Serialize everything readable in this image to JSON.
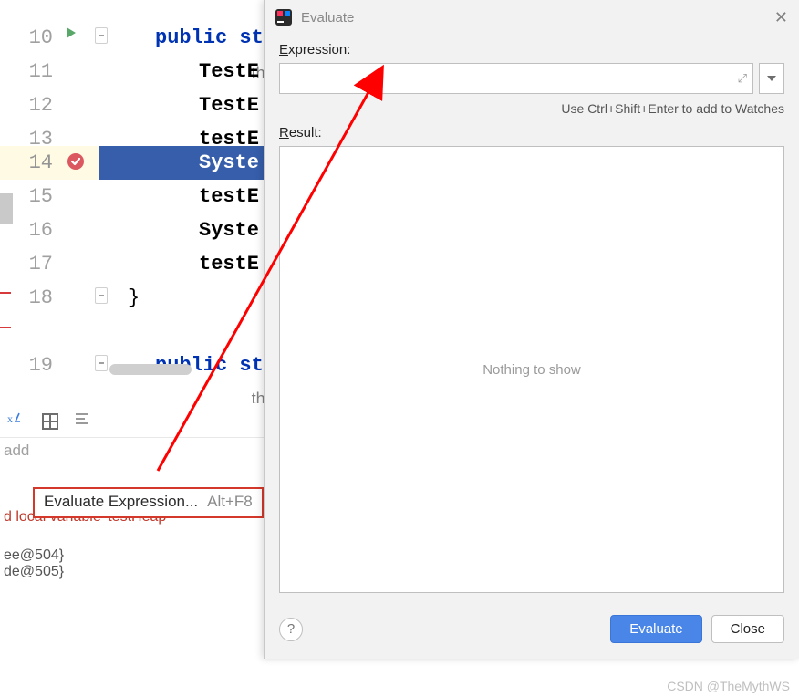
{
  "editor": {
    "lines": [
      {
        "num": "",
        "text": "themyth"
      },
      {
        "num": "10",
        "text": "public st"
      },
      {
        "num": "11",
        "text": "TestE"
      },
      {
        "num": "12",
        "text": "TestE"
      },
      {
        "num": "13",
        "text": "testE"
      },
      {
        "num": "14",
        "text": "Syste"
      },
      {
        "num": "15",
        "text": "testE"
      },
      {
        "num": "16",
        "text": "Syste"
      },
      {
        "num": "17",
        "text": "testE"
      },
      {
        "num": "18",
        "text": "}"
      },
      {
        "num": "",
        "text": "themyth"
      },
      {
        "num": "19",
        "text": "public st"
      }
    ],
    "author": "themyth"
  },
  "debug": {
    "add": "add",
    "tooltip_text": "Evaluate Expression...",
    "tooltip_shortcut": "Alt+F8",
    "red_line": "d local variable 'testHeap'",
    "obj1": "ee@504}",
    "obj2": "de@505}"
  },
  "dialog": {
    "title": "Evaluate",
    "expression_label": "Expression:",
    "expression_value": "",
    "hint": "Use Ctrl+Shift+Enter to add to Watches",
    "result_label": "Result:",
    "result_placeholder": "Nothing to show",
    "evaluate_btn": "Evaluate",
    "close_btn": "Close"
  },
  "watermark": "CSDN @TheMythWS"
}
